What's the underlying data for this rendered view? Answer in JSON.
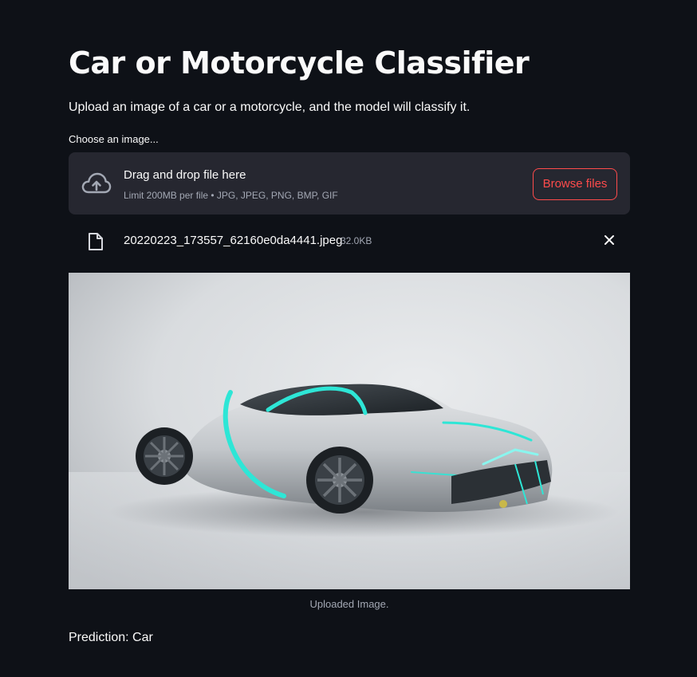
{
  "page": {
    "title": "Car or Motorcycle Classifier",
    "subtitle": "Upload an image of a car or a motorcycle, and the model will classify it."
  },
  "uploader": {
    "label": "Choose an image...",
    "drop_title": "Drag and drop file here",
    "limit_text": "Limit 200MB per file • JPG, JPEG, PNG, BMP, GIF",
    "browse_label": "Browse files",
    "icon": "cloud-upload-icon"
  },
  "uploaded_file": {
    "name": "20220223_173557_62160e0da4441.jpeg",
    "size": "32.0KB",
    "icon": "file-icon",
    "remove_icon": "close-icon"
  },
  "image": {
    "caption": "Uploaded Image."
  },
  "result": {
    "prediction": "Prediction: Car"
  },
  "colors": {
    "background": "#0e1117",
    "dropzone": "#262730",
    "accent": "#ff4b4b",
    "text": "#fafafa",
    "muted": "#a3a8b4",
    "car_trim": "#2ee6d6"
  }
}
